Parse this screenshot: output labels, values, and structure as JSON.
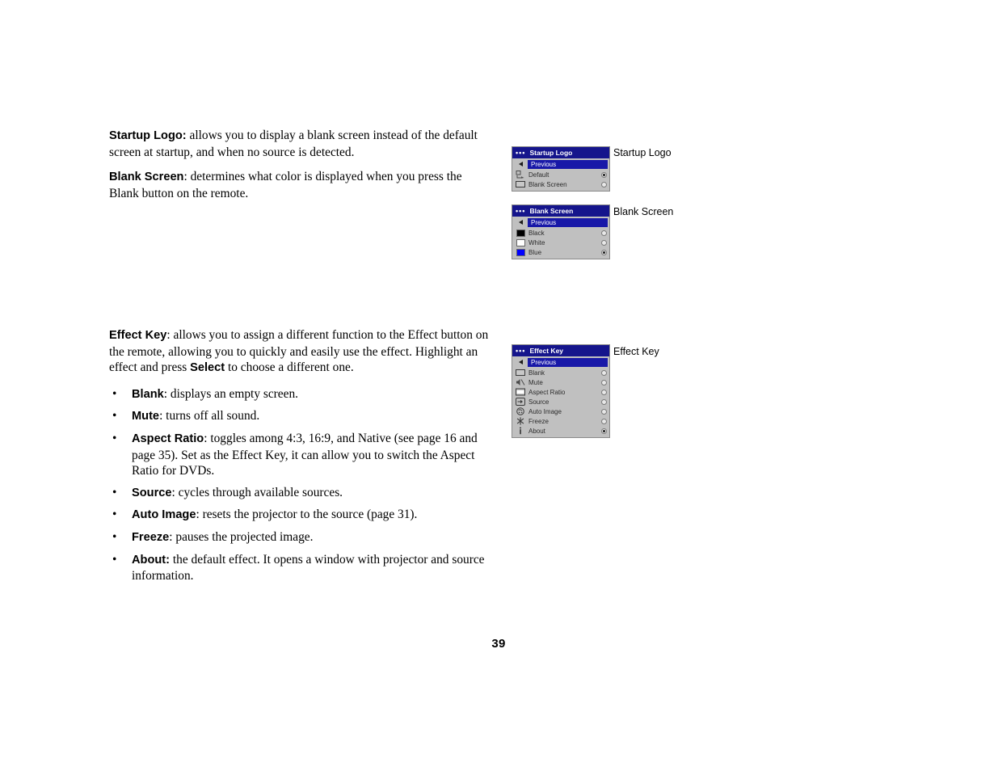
{
  "document": {
    "page_number": "39"
  },
  "body": {
    "startup_logo": {
      "term": "Startup Logo:",
      "text": " allows you to display a blank screen instead of the default screen at startup, and when no source is detected."
    },
    "blank_screen": {
      "term": "Blank Screen",
      "text": ": determines what color is displayed when you press the Blank button on the remote."
    },
    "effect_key": {
      "term": "Effect Key",
      "text_1": ": allows you to assign a different function to the Effect button on the remote, allowing you to quickly and easily use the effect. Highlight an effect and press ",
      "bold_select": "Select",
      "text_2": " to choose a different one."
    },
    "bullets": [
      {
        "bullet": "•",
        "term": "Blank",
        "text": ": displays an empty screen."
      },
      {
        "bullet": "•",
        "term": "Mute",
        "text": ": turns off all sound."
      },
      {
        "bullet": "•",
        "term": "Aspect Ratio",
        "text": ": toggles among 4:3, 16:9, and Native (see page 16 and page 35). Set as the Effect Key, it can allow you to switch the Aspect Ratio for DVDs."
      },
      {
        "bullet": "•",
        "term": "Source",
        "text": ": cycles through available sources."
      },
      {
        "bullet": "•",
        "term": "Auto Image",
        "text": ": resets the projector to the source (page 31)."
      },
      {
        "bullet": "•",
        "term": "Freeze",
        "text": ": pauses the projected image."
      },
      {
        "bullet": "•",
        "term": "About:",
        "text": " the default effect. It opens a window with projector and source information."
      }
    ]
  },
  "captions": {
    "startup_logo": "Startup Logo",
    "blank_screen": "Blank Screen",
    "effect_key": "Effect Key"
  },
  "colors": {
    "title_bar": "#15158c",
    "highlight": "#1818a8",
    "menu_body": "#c0c0c0",
    "swatch_black": "#000000",
    "swatch_white": "#ffffff",
    "swatch_blue": "#0000ff"
  },
  "menus": {
    "startup_logo": {
      "title": "Startup Logo",
      "dots": "•••",
      "previous_label": "Previous",
      "items": [
        {
          "label": "Default",
          "icon": "logo-icon",
          "selected": true
        },
        {
          "label": "Blank Screen",
          "icon": "screen-icon",
          "selected": false
        }
      ]
    },
    "blank_screen": {
      "title": "Blank Screen",
      "dots": "•••",
      "previous_label": "Previous",
      "items": [
        {
          "label": "Black",
          "icon": "swatch-black",
          "swatch": "#000000",
          "selected": false
        },
        {
          "label": "White",
          "icon": "swatch-white",
          "swatch": "#ffffff",
          "selected": false
        },
        {
          "label": "Blue",
          "icon": "swatch-blue",
          "swatch": "#0000ff",
          "selected": true
        }
      ]
    },
    "effect_key": {
      "title": "Effect Key",
      "dots": "•••",
      "previous_label": "Previous",
      "items": [
        {
          "label": "Blank",
          "icon": "screen-icon",
          "selected": false
        },
        {
          "label": "Mute",
          "icon": "mute-icon",
          "selected": false
        },
        {
          "label": "Aspect Ratio",
          "icon": "aspect-ratio-icon",
          "selected": false
        },
        {
          "label": "Source",
          "icon": "source-icon",
          "selected": false
        },
        {
          "label": "Auto Image",
          "icon": "auto-image-icon",
          "selected": false
        },
        {
          "label": "Freeze",
          "icon": "freeze-icon",
          "selected": false
        },
        {
          "label": "About",
          "icon": "info-icon",
          "selected": true
        }
      ]
    }
  }
}
